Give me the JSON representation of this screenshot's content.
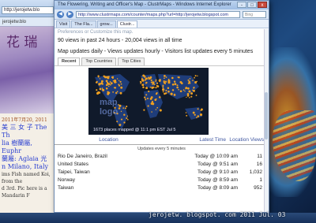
{
  "background_window": {
    "address": "http://jerojetw.blo",
    "tab_label": "jerojetw.blo",
    "art_text": "花 瑞",
    "post_date": "2011年7月20, 2011",
    "lines": [
      "美 三 女 子 The Th",
      "lia 樹蘭屬, Euphr",
      "蘭屬: Aglaia 光",
      "n Milano, Italy",
      "ims Fish named Koi, from the",
      "d 3rd. Pic here is a Mandarin F"
    ]
  },
  "browser": {
    "title": "The Flowering, Writing and Officer's Map - ClustrMaps - Windows Internet Explorer",
    "address": "http://www.clustrmaps.com/counter/maps.php?url=http://jerojetw.blogspot.com",
    "search_placeholder": "Bing",
    "window_controls": {
      "minimize": "-",
      "maximize": "□",
      "close": "x"
    },
    "tabs": [
      "Visit",
      "The Fla...",
      "grow...",
      "Clustr..."
    ]
  },
  "page": {
    "links": "Preferences or Customize this map.",
    "views_line": "90 views in past 24 hours - 20,004 views in all time",
    "updates_line": "Map updates daily - Views updates hourly - Visitors list updates every 5 minutes",
    "tabs": [
      "Recent",
      "Top Countries",
      "Top Cities"
    ],
    "map_logo_top": "map",
    "map_logo_bottom": "logo",
    "map_caption": "1673 places mapped @ 11:1 pm EST Jul 5",
    "table": {
      "headers": [
        "Location",
        "Latest Time",
        "Location Views"
      ],
      "note": "Updates every 5 minutes",
      "rows": [
        {
          "location": "Rio De Janeiro, Brazil",
          "time": "Today @ 10:09 am",
          "views": "11"
        },
        {
          "location": "United States",
          "time": "Today @ 9:51 am",
          "views": "16"
        },
        {
          "location": "Taipei, Taiwan",
          "time": "Today @ 9:10 am",
          "views": "1,032"
        },
        {
          "location": "Norway",
          "time": "Today @ 8:59 am",
          "views": "1"
        },
        {
          "location": "Taiwan",
          "time": "Today @ 8:09 am",
          "views": "952"
        }
      ]
    }
  },
  "watermark": "jerojetw. blogspot. com   2011 Jul. 03",
  "colors": {
    "map_background": "#101a2b",
    "map_dots": "#f0a020",
    "land": "#1f3d7a"
  }
}
